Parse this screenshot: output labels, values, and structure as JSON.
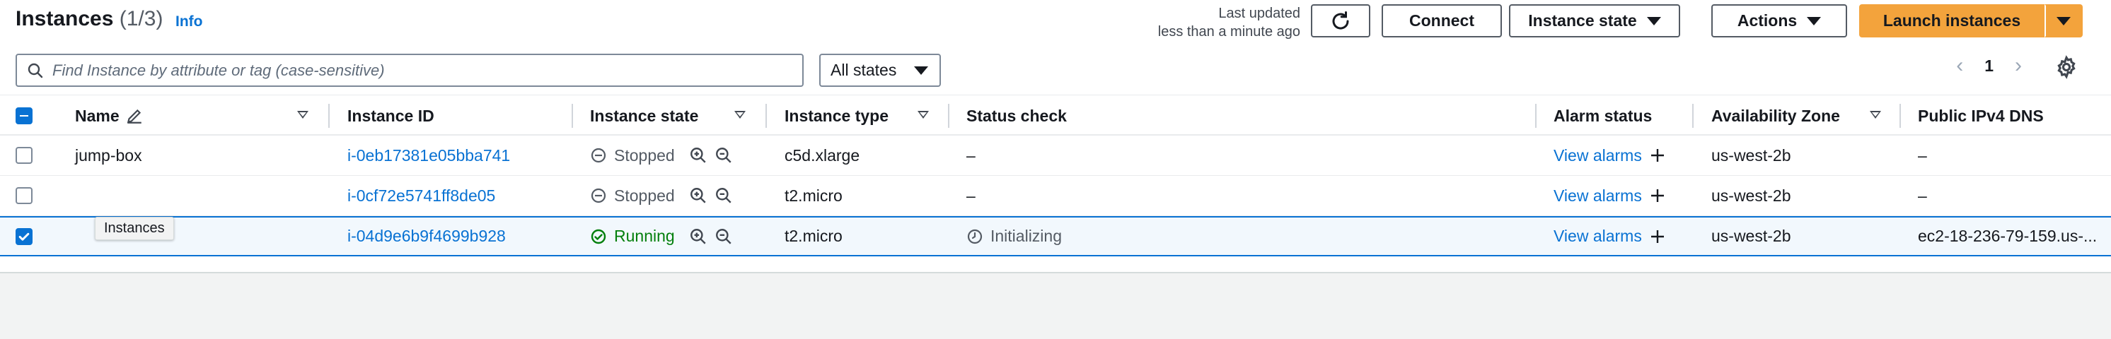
{
  "header": {
    "title": "Instances",
    "count": "(1/3)",
    "info": "Info",
    "last_updated_line1": "Last updated",
    "last_updated_line2": "less than a minute ago",
    "connect": "Connect",
    "instance_state": "Instance state",
    "actions": "Actions",
    "launch": "Launch instances"
  },
  "filter": {
    "search_placeholder": "Find Instance by attribute or tag (case-sensitive)",
    "states_value": "All states"
  },
  "pagination": {
    "page": "1"
  },
  "columns": {
    "name": "Name",
    "instance_id": "Instance ID",
    "instance_state": "Instance state",
    "instance_type": "Instance type",
    "status_check": "Status check",
    "alarm_status": "Alarm status",
    "availability_zone": "Availability Zone",
    "public_dns": "Public IPv4 DNS"
  },
  "rows": [
    {
      "name": "jump-box",
      "id": "i-0eb17381e05bba741",
      "state": "Stopped",
      "type": "c5d.xlarge",
      "status": "–",
      "alarm": "View alarms",
      "az": "us-west-2b",
      "dns": "–"
    },
    {
      "name": "",
      "id": "i-0cf72e5741ff8de05",
      "state": "Stopped",
      "type": "t2.micro",
      "status": "–",
      "alarm": "View alarms",
      "az": "us-west-2b",
      "dns": "–"
    },
    {
      "name": "",
      "id": "i-04d9e6b9f4699b928",
      "state": "Running",
      "type": "t2.micro",
      "status": "Initializing",
      "alarm": "View alarms",
      "az": "us-west-2b",
      "dns": "ec2-18-236-79-159.us-..."
    }
  ],
  "tooltip": "Instances",
  "colors": {
    "accent": "#0972d3",
    "primary_button": "#f3a33c",
    "running": "#037f0c",
    "stopped": "#545b64"
  }
}
